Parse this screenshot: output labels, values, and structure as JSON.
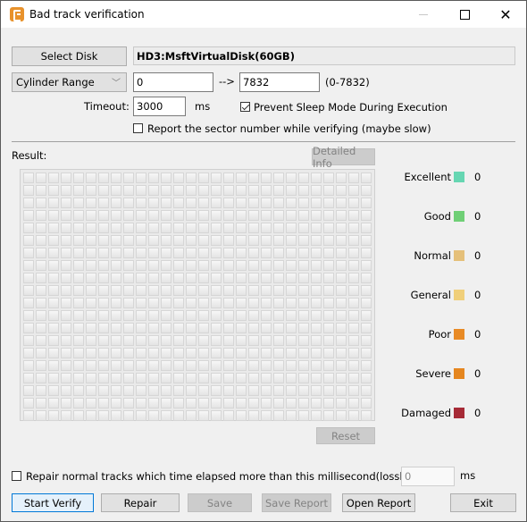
{
  "window": {
    "title": "Bad track verification",
    "controls": {
      "minimize": "minimize",
      "maximize": "maximize",
      "close": "close"
    }
  },
  "disk": {
    "select_label": "Select Disk",
    "selected": "HD3:MsftVirtualDisk(60GB)"
  },
  "range": {
    "mode": "Cylinder Range",
    "from": "0",
    "arrow": "-->",
    "to": "7832",
    "limits": "(0-7832)"
  },
  "timeout": {
    "label": "Timeout:",
    "value": "3000",
    "unit": "ms"
  },
  "options": {
    "prevent_sleep": {
      "label": "Prevent Sleep Mode During Execution",
      "checked": true
    },
    "report_sector": {
      "label": "Report the sector number while verifying (maybe slow)",
      "checked": false
    }
  },
  "result": {
    "label": "Result:",
    "detailed_info_label": "Detailed Info",
    "reset_label": "Reset",
    "grid": {
      "columns": 28,
      "rows": 20
    }
  },
  "legend": [
    {
      "name": "Excellent",
      "color": "#66d6b2",
      "count": "0"
    },
    {
      "name": "Good",
      "color": "#6fcf76",
      "count": "0"
    },
    {
      "name": "Normal",
      "color": "#e5c07a",
      "count": "0"
    },
    {
      "name": "General",
      "color": "#f0cf7a",
      "count": "0"
    },
    {
      "name": "Poor",
      "color": "#e88a25",
      "count": "0"
    },
    {
      "name": "Severe",
      "color": "#e5861f",
      "count": "0"
    },
    {
      "name": "Damaged",
      "color": "#a62a36",
      "count": "0"
    }
  ],
  "repair_option": {
    "label": "Repair normal tracks which time elapsed more than this millisecond(lossless):",
    "checked": false,
    "value": "0",
    "unit": "ms"
  },
  "buttons": {
    "start_verify": "Start Verify",
    "repair": "Repair",
    "save": "Save",
    "save_report": "Save Report",
    "open_report": "Open Report",
    "exit": "Exit"
  }
}
